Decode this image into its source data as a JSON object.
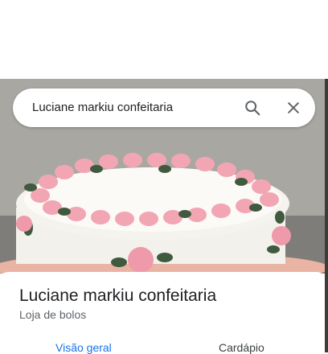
{
  "search": {
    "query": "Luciane markiu confeitaria"
  },
  "place": {
    "name": "Luciane markiu confeitaria",
    "category": "Loja de bolos"
  },
  "tabs": [
    {
      "label": "Visão geral",
      "active": true
    },
    {
      "label": "Cardápio",
      "active": false
    }
  ],
  "colors": {
    "active_tab": "#1a73e8",
    "inactive_tab": "#3c4043"
  },
  "icons": {
    "search": "search-icon",
    "close": "close-icon"
  }
}
